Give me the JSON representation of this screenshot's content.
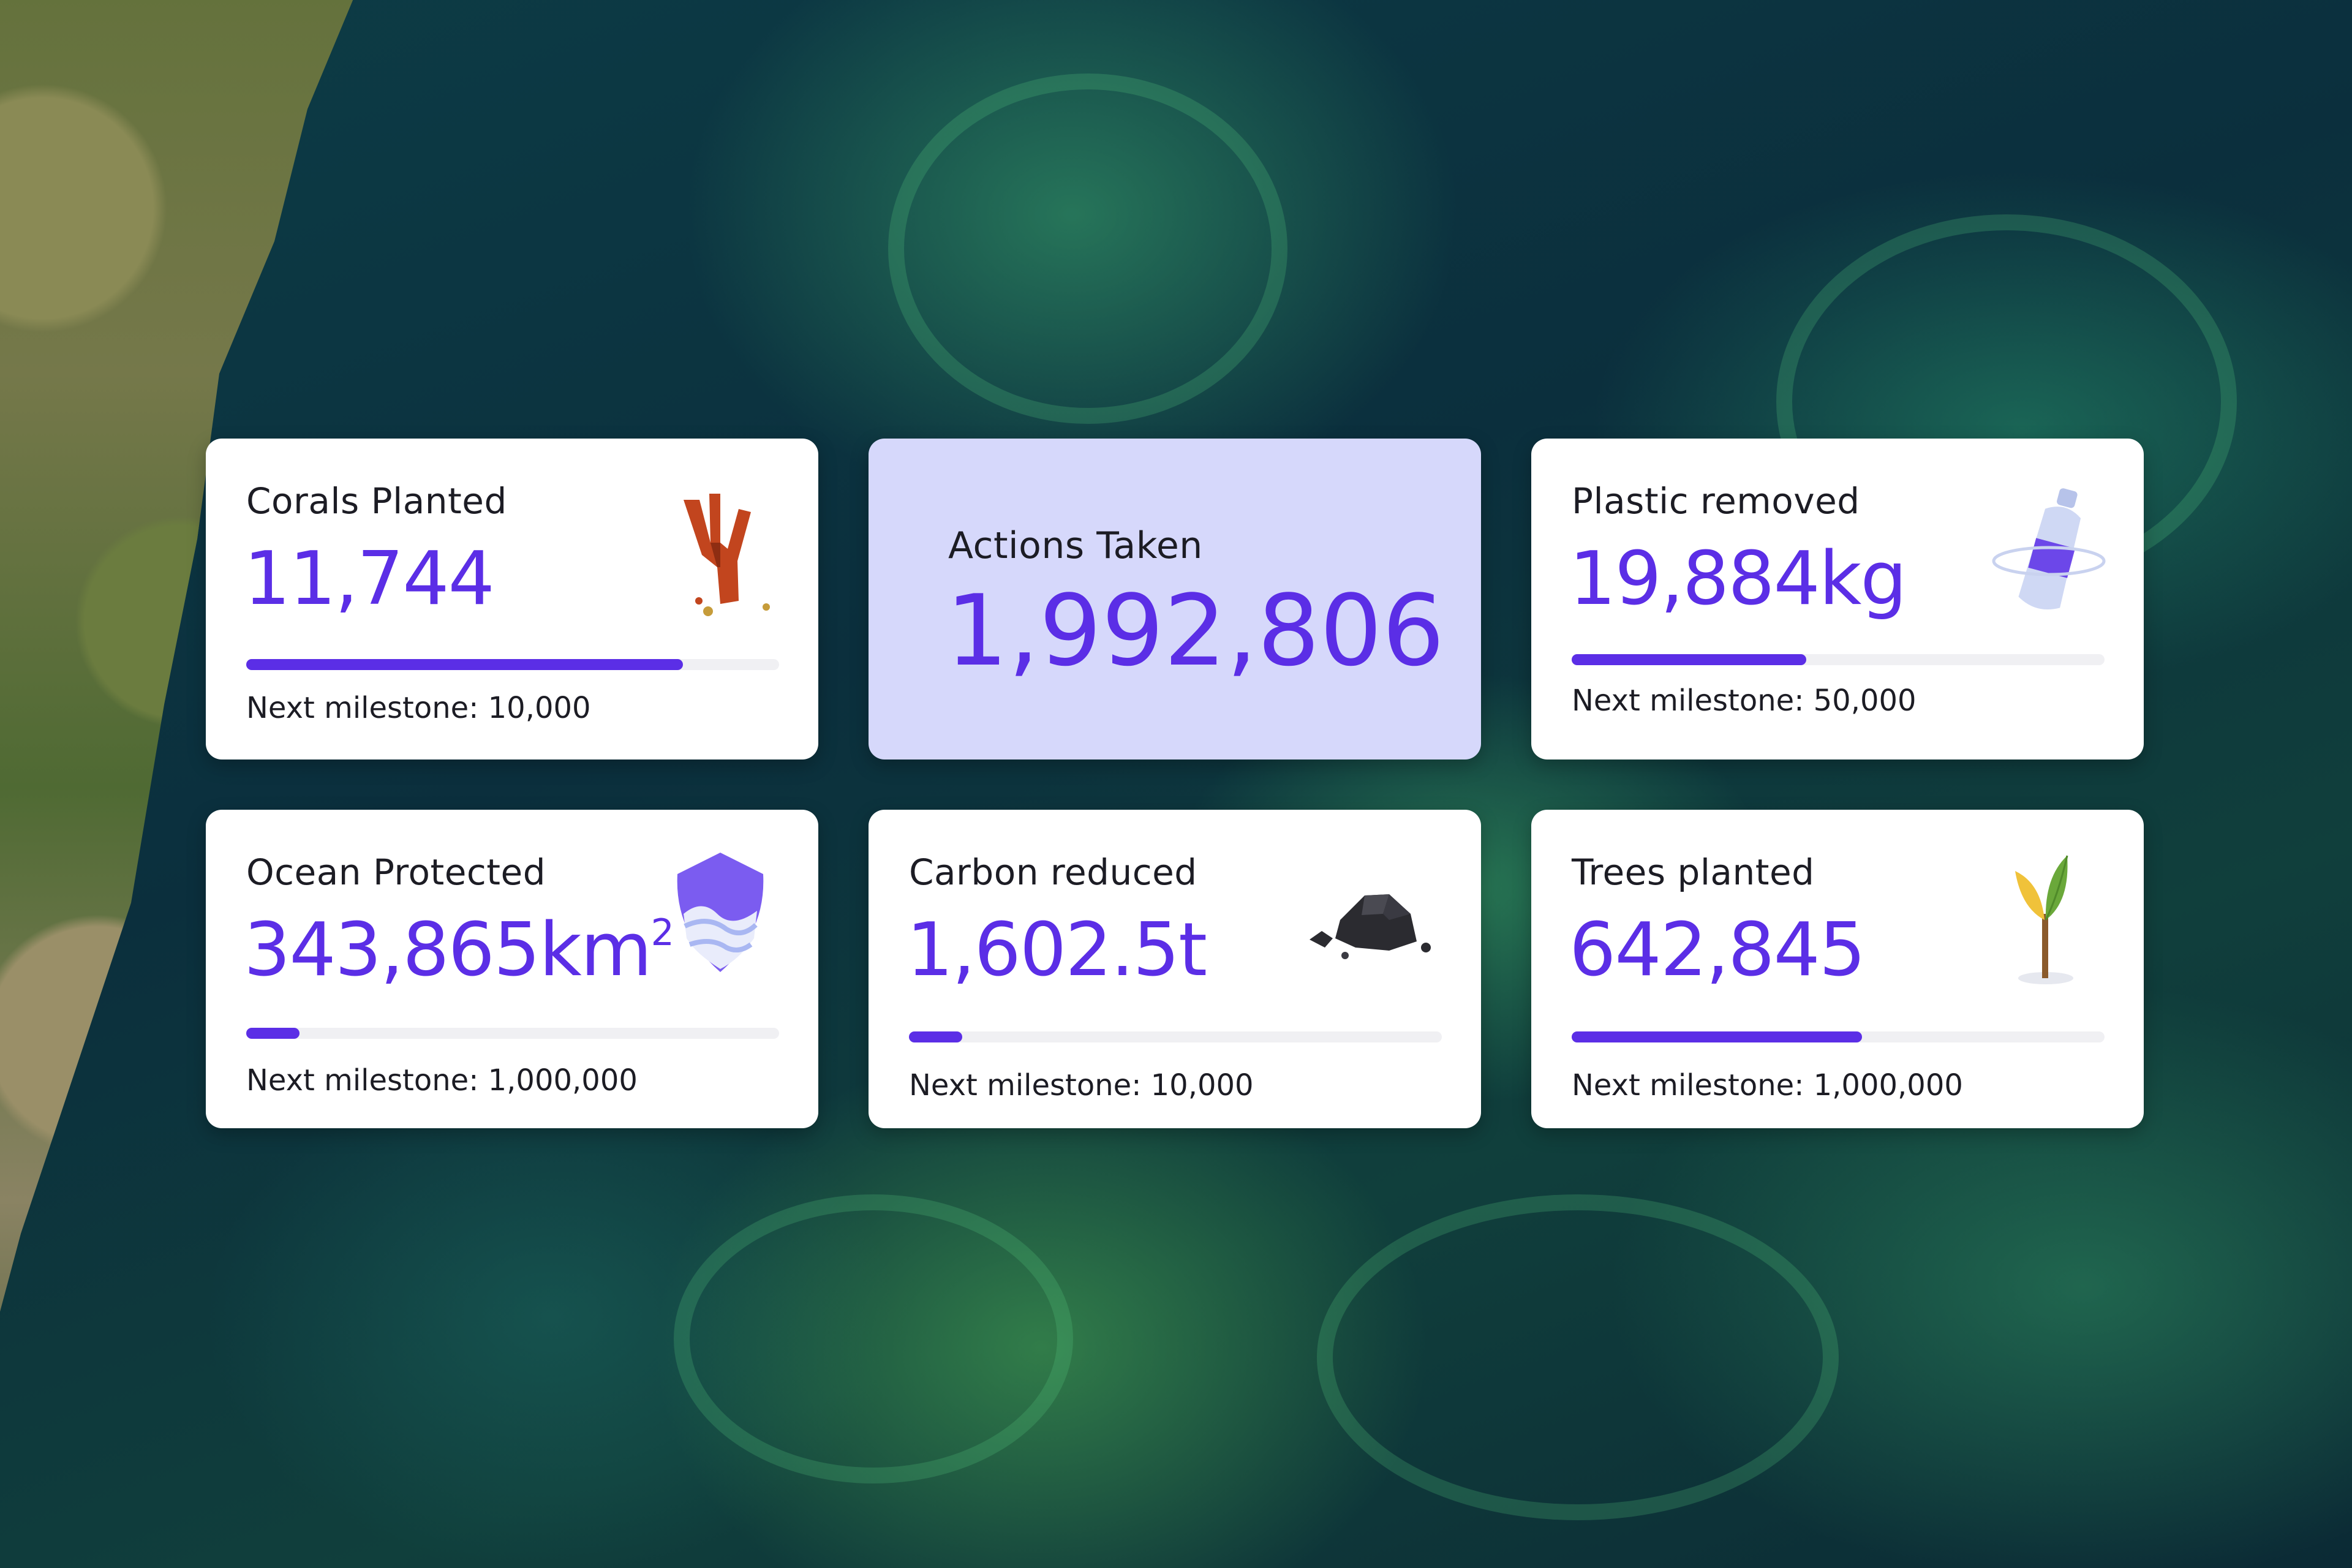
{
  "cards": {
    "corals": {
      "title": "Corals Planted",
      "value": "11,744",
      "milestone": "Next milestone: 10,000",
      "progress": 0.82,
      "icon": "coral-icon"
    },
    "actions": {
      "title": "Actions Taken",
      "value": "1,992,806"
    },
    "plastic": {
      "title": "Plastic removed",
      "value": "19,884kg",
      "milestone": "Next milestone: 50,000",
      "progress": 0.44,
      "icon": "plastic-bottle-icon"
    },
    "ocean": {
      "title": "Ocean Protected",
      "value": "343,865km",
      "value_suffix": "2",
      "milestone": "Next milestone: 1,000,000",
      "progress": 0.1,
      "icon": "ocean-shield-icon"
    },
    "carbon": {
      "title": "Carbon reduced",
      "value": "1,602.5t",
      "milestone": "Next milestone: 10,000",
      "progress": 0.1,
      "icon": "coal-icon"
    },
    "trees": {
      "title": "Trees planted",
      "value": "642,845",
      "milestone": "Next milestone: 1,000,000",
      "progress": 0.545,
      "icon": "sapling-icon"
    }
  },
  "colors": {
    "accent": "#5b2ee6",
    "feature_card": "#d6d8fb",
    "track": "#f0f0f3"
  }
}
